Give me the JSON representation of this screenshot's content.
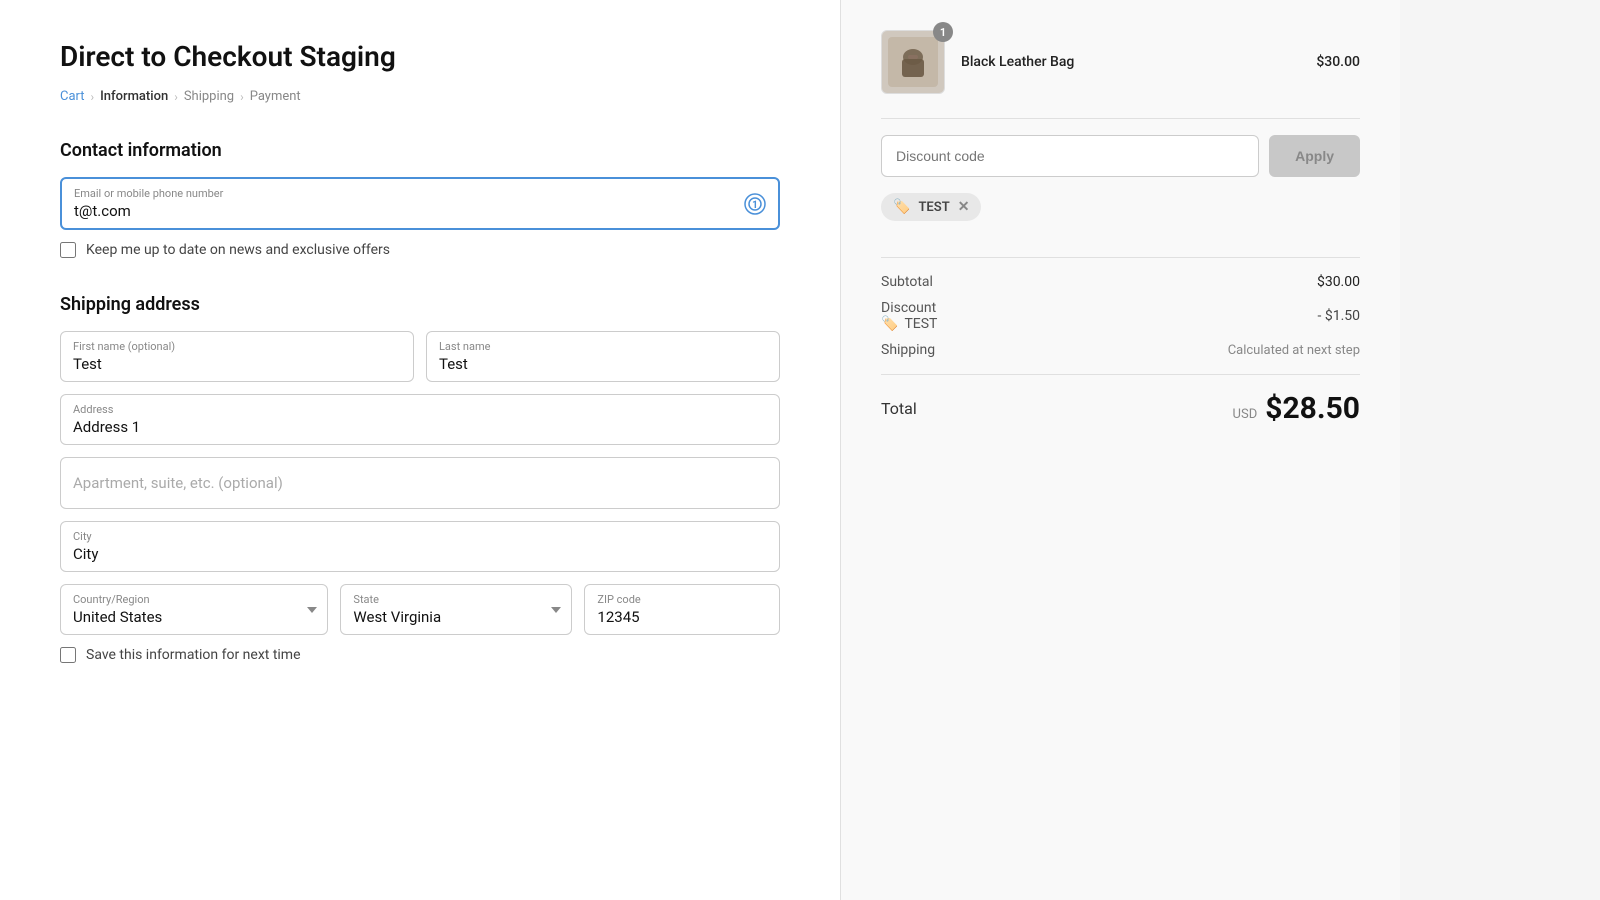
{
  "page": {
    "title": "Direct to Checkout Staging"
  },
  "breadcrumb": {
    "cart": "Cart",
    "information": "Information",
    "shipping": "Shipping",
    "payment": "Payment"
  },
  "contact": {
    "section_title": "Contact information",
    "email_label": "Email or mobile phone number",
    "email_value": "t@t.com",
    "newsletter_label": "Keep me up to date on news and exclusive offers"
  },
  "shipping": {
    "section_title": "Shipping address",
    "first_name_label": "First name (optional)",
    "first_name_value": "Test",
    "last_name_label": "Last name",
    "last_name_value": "Test",
    "address_label": "Address",
    "address_value": "Address 1",
    "apt_placeholder": "Apartment, suite, etc. (optional)",
    "city_label": "City",
    "city_value": "City",
    "country_label": "Country/Region",
    "country_value": "United States",
    "state_label": "State",
    "state_value": "West Virginia",
    "zip_label": "ZIP code",
    "zip_value": "12345",
    "save_label": "Save this information for next time"
  },
  "order": {
    "product_name": "Black Leather Bag",
    "product_price": "$30.00",
    "product_badge": "1",
    "discount_placeholder": "Discount code",
    "apply_label": "Apply",
    "tag_label": "TEST",
    "subtotal_label": "Subtotal",
    "subtotal_value": "$30.00",
    "discount_label": "Discount",
    "discount_code": "TEST",
    "discount_value": "- $1.50",
    "shipping_label": "Shipping",
    "shipping_value": "Calculated at next step",
    "total_label": "Total",
    "total_currency": "USD",
    "total_amount": "$28.50"
  }
}
